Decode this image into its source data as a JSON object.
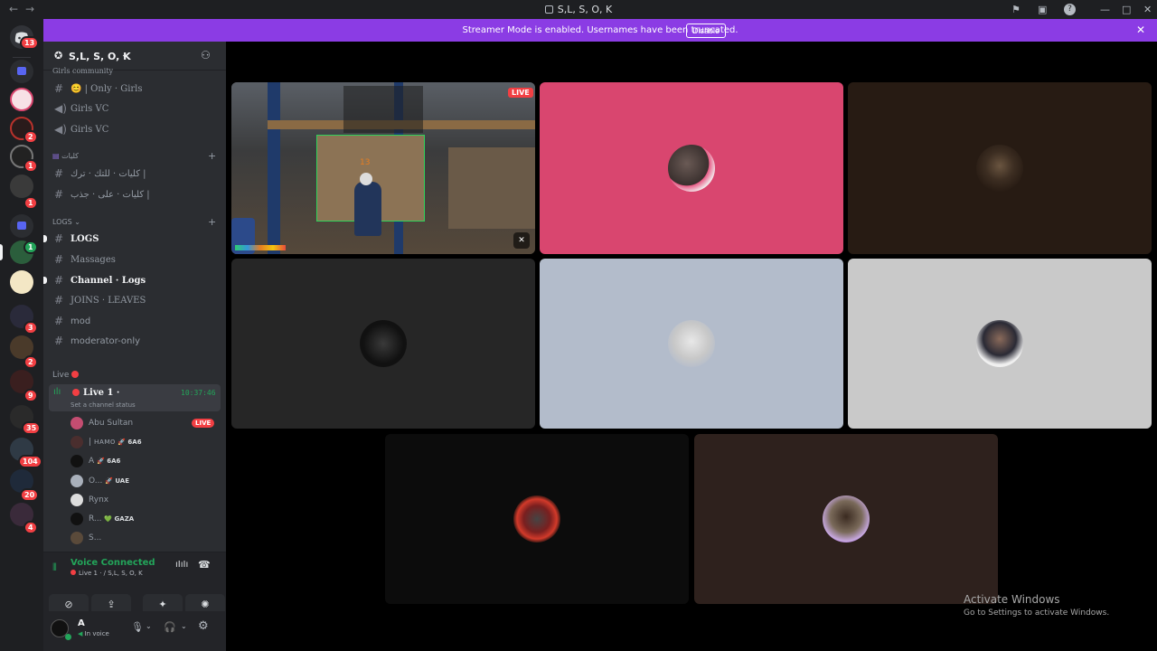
{
  "window": {
    "title": "S,L, S, O, K"
  },
  "banner": {
    "text": "Streamer Mode is enabled. Usernames have been truncated.",
    "disable_label": "Disable"
  },
  "guilds": {
    "home_badge": "13",
    "badges": [
      "2",
      "1",
      "1",
      "1",
      "3",
      "2",
      "9",
      "35",
      "104",
      "20",
      "4"
    ]
  },
  "server": {
    "name": "S,L, S, O, K",
    "category_girls": "Girls community",
    "channels_top": [
      {
        "label": "😊 | Only · Girls",
        "type": "text"
      },
      {
        "label": "Girls VC",
        "type": "voice"
      },
      {
        "label": "Girls VC",
        "type": "voice"
      }
    ],
    "category_arabic": "كليات",
    "channels_arabic": [
      {
        "label": "كليات · للتك · ترك |"
      },
      {
        "label": "كليات · على · جذب |"
      }
    ],
    "category_logs": "LOGS",
    "channels_logs": [
      {
        "label": "LOGS",
        "unread": true
      },
      {
        "label": "Massages",
        "unread": false
      },
      {
        "label": "Channel · Logs",
        "unread": true
      },
      {
        "label": "JOINS · LEAVES",
        "unread": false
      },
      {
        "label": "mod",
        "unread": false
      },
      {
        "label": "moderator-only",
        "unread": false
      }
    ],
    "category_live": "Live",
    "voice_channel": {
      "label": "Live 1 ·",
      "timer": "10:37:46",
      "status_placeholder": "Set a channel status"
    },
    "members": [
      {
        "name": "Abu Sultan",
        "tag": "",
        "live": true,
        "live_label": "LIVE"
      },
      {
        "name": "| ʜᴀᴍᴏ",
        "tag": "🚀 6A6",
        "live": false
      },
      {
        "name": "A",
        "tag": "🚀 6A6",
        "live": false
      },
      {
        "name": "O...",
        "tag": "🚀 UAE",
        "live": false
      },
      {
        "name": "Rynx",
        "tag": "",
        "live": false
      },
      {
        "name": "R...",
        "tag": "💚 GAZA",
        "live": false
      },
      {
        "name": "S...",
        "tag": "",
        "live": false
      }
    ]
  },
  "voice_connection": {
    "status": "Voice Connected",
    "location": "Live 1 · / S,L, S, O, K"
  },
  "user_panel": {
    "name": "A",
    "status": "In voice"
  },
  "stage": {
    "live_label": "LIVE",
    "stream_hud_number": "13",
    "tiles": [
      {
        "kind": "stream",
        "bg": "#3a3a3a"
      },
      {
        "kind": "avatar",
        "bg": "#d9466f"
      },
      {
        "kind": "avatar",
        "bg": "#271b13"
      },
      {
        "kind": "avatar",
        "bg": "#262626"
      },
      {
        "kind": "avatar",
        "bg": "#b3bccb"
      },
      {
        "kind": "avatar",
        "bg": "#c9c9c9"
      },
      {
        "kind": "avatar",
        "bg": "#0c0c0c"
      },
      {
        "kind": "avatar",
        "bg": "#2e211d"
      }
    ]
  },
  "watermark": {
    "title": "Activate Windows",
    "subtitle": "Go to Settings to activate Windows."
  },
  "colors": {
    "brand_purple": "#8b3ce4",
    "danger": "#f23f43",
    "voice_green": "#23a55a"
  }
}
